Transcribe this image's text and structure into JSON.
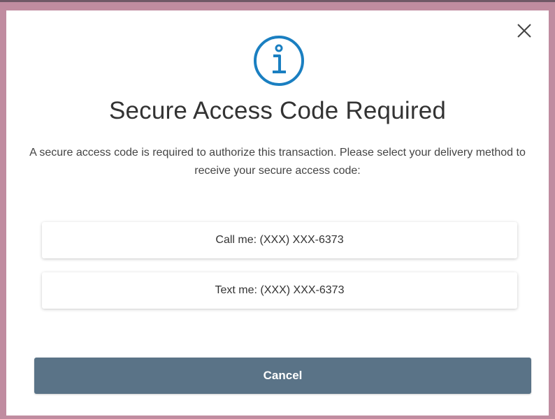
{
  "dialog": {
    "title": "Secure Access Code Required",
    "description": "A secure access code is required to authorize this transaction. Please select your delivery method to receive your secure access code:",
    "options": [
      {
        "label": "Call me: (XXX) XXX-6373"
      },
      {
        "label": "Text me: (XXX) XXX-6373"
      }
    ],
    "cancel_label": "Cancel",
    "icons": {
      "header": "info-icon",
      "close": "close-icon"
    }
  },
  "colors": {
    "backdrop": "#c08ca0",
    "info_icon": "#1a7fc1",
    "cancel_button": "#5a7387",
    "title_text": "#333333"
  }
}
